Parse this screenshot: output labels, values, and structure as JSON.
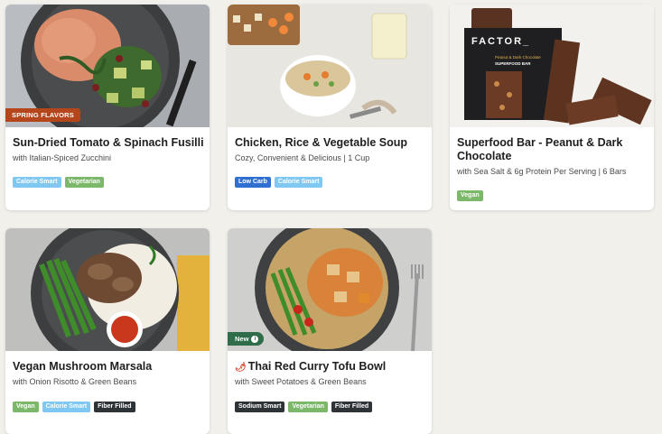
{
  "cards": [
    {
      "title": "Sun-Dried Tomato & Spinach Fusilli",
      "subtitle": "with Italian-Spiced Zucchini",
      "badge": "SPRING FLAVORS",
      "tags": [
        "Calorie Smart",
        "Vegetarian"
      ]
    },
    {
      "title": "Chicken, Rice & Vegetable Soup",
      "subtitle": "Cozy, Convenient & Delicious | 1 Cup",
      "tags": [
        "Low Carb",
        "Calorie Smart"
      ]
    },
    {
      "title": "Superfood Bar - Peanut & Dark Chocolate",
      "subtitle": "with Sea Salt & 6g Protein Per Serving | 6 Bars",
      "tags": [
        "Vegan"
      ],
      "package_brand": "FACTOR_",
      "package_line1": "Peanut & Dark Chocolate",
      "package_line2": "SUPERFOOD BAR"
    },
    {
      "title": "Vegan Mushroom Marsala",
      "subtitle": "with Onion Risotto & Green Beans",
      "tags": [
        "Vegan",
        "Calorie Smart",
        "Fiber Filled"
      ]
    },
    {
      "title": "Thai Red Curry Tofu Bowl",
      "subtitle": "with Sweet Potatoes & Green Beans",
      "badge": "New",
      "tags": [
        "Sodium Smart",
        "Vegetarian",
        "Fiber Filled"
      ]
    }
  ],
  "colors": {
    "page_bg": "#f1f0eb",
    "calorie_smart": "#7fc8f2",
    "vegetarian": "#7bb86a",
    "low_carb": "#2f6fd1",
    "fiber_filled": "#2e3338",
    "spring_badge": "#b5451b",
    "new_badge": "#2e6c4a"
  },
  "icons": {
    "new_badge_icon": "info-icon",
    "spicy_icon": "chili-pepper-icon"
  }
}
